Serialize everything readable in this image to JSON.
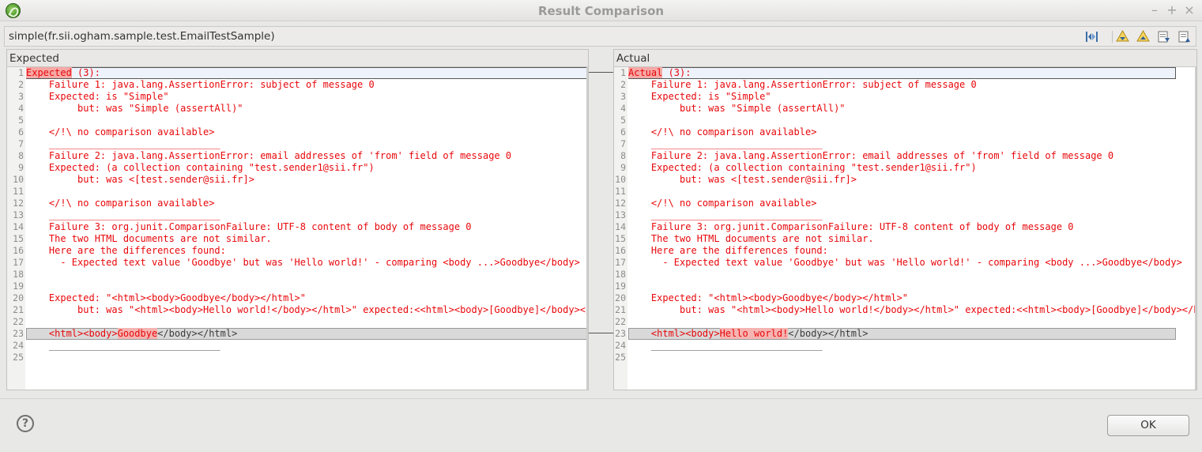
{
  "window": {
    "title": "Result Comparison"
  },
  "header": {
    "title": "simple(fr.sii.ogham.sample.test.EmailTestSample)"
  },
  "toolbar": [
    "two-way-compare-icon",
    "next-difference-icon",
    "previous-difference-icon",
    "next-change-icon",
    "previous-change-icon"
  ],
  "left": {
    "label": "Expected",
    "lines": [
      "1",
      "2",
      "3",
      "4",
      "5",
      "6",
      "7",
      "8",
      "9",
      "10",
      "11",
      "12",
      "13",
      "14",
      "15",
      "16",
      "17",
      "18",
      "19",
      "20",
      "21",
      "22",
      "23",
      "24",
      "25"
    ],
    "text": [
      "Expected (3):",
      "    Failure 1: java.lang.AssertionError: subject of message 0",
      "    Expected: is \"Simple\"",
      "         but: was \"Simple (assertAll)\"",
      "",
      "    </!\\ no comparison available>",
      "    ______________________________",
      "    Failure 2: java.lang.AssertionError: email addresses of 'from' field of message 0",
      "    Expected: (a collection containing \"test.sender1@sii.fr\")",
      "         but: was <[test.sender@sii.fr]>",
      "",
      "    </!\\ no comparison available>",
      "    ______________________________",
      "    Failure 3: org.junit.ComparisonFailure: UTF-8 content of body of message 0",
      "    The two HTML documents are not similar.",
      "    Here are the differences found:",
      "      - Expected text value 'Goodbye' but was 'Hello world!' - comparing <body ...>Goodbye</body>",
      "",
      "",
      "    Expected: \"<html><body>Goodbye</body></html>\"",
      "         but: was \"<html><body>Hello world!</body></html>\" expected:<<html><body>[Goodbye]</body></html>>",
      "",
      "    <html><body>Goodbye</body></html>",
      "    ______________________________",
      ""
    ]
  },
  "right": {
    "label": "Actual",
    "text": [
      "Actual (3):",
      "    Failure 1: java.lang.AssertionError: subject of message 0",
      "    Expected: is \"Simple\"",
      "         but: was \"Simple (assertAll)\"",
      "",
      "    </!\\ no comparison available>",
      "    ______________________________",
      "    Failure 2: java.lang.AssertionError: email addresses of 'from' field of message 0",
      "    Expected: (a collection containing \"test.sender1@sii.fr\")",
      "         but: was <[test.sender@sii.fr]>",
      "",
      "    </!\\ no comparison available>",
      "    ______________________________",
      "    Failure 3: org.junit.ComparisonFailure: UTF-8 content of body of message 0",
      "    The two HTML documents are not similar.",
      "    Here are the differences found:",
      "      - Expected text value 'Goodbye' but was 'Hello world!' - comparing <body ...>Goodbye</body>",
      "",
      "",
      "    Expected: \"<html><body>Goodbye</body></html>\"",
      "         but: was \"<html><body>Hello world!</body></html>\" expected:<<html><body>[Goodbye]</body></html>>",
      "",
      "    <html><body>Hello world!</body></html>",
      "    ______________________________",
      ""
    ]
  },
  "line23": {
    "left_pre": "    <html><body>",
    "left_diff": "Goodbye",
    "left_post": "</body></html>",
    "right_pre": "    <html><body>",
    "right_diff": "Hello world!",
    "right_post": "</body></html>"
  },
  "line1": {
    "left_word": "Expected",
    "left_rest": " (3):",
    "right_word": "Actual",
    "right_rest": " (3):"
  },
  "buttons": {
    "ok": "OK",
    "help": "?"
  },
  "window_buttons": {
    "minimize": "–",
    "maximize": "+",
    "close": "×"
  }
}
